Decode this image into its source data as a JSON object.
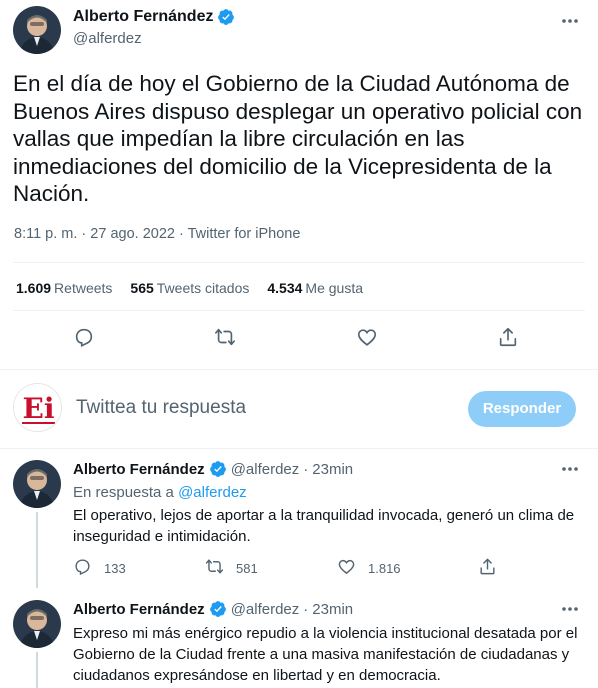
{
  "main_tweet": {
    "author_name": "Alberto Fernández",
    "author_handle": "@alferdez",
    "text": "En el día de hoy el Gobierno de la Ciudad Autónoma de Buenos Aires dispuso desplegar un operativo policial con vallas que impedían la libre circulación en las inmediaciones del domicilio de la Vicepresidenta de la Nación.",
    "time": "8:11 p. m. · 27 ago. 2022 ·",
    "source": "Twitter for iPhone",
    "stats": {
      "retweets_count": "1.609",
      "retweets_label": "Retweets",
      "quotes_count": "565",
      "quotes_label": "Tweets citados",
      "likes_count": "4.534",
      "likes_label": "Me gusta"
    },
    "actions": [
      "reply-icon",
      "retweet-icon",
      "like-icon",
      "share-icon"
    ]
  },
  "reply_box": {
    "logo_text": "Ei",
    "placeholder": "Twittea tu respuesta",
    "button_label": "Responder"
  },
  "replies": [
    {
      "author_name": "Alberto Fernández",
      "author_handle": "@alferdez",
      "dot": "·",
      "time": "23min",
      "reply_to_prefix": "En respuesta a",
      "reply_to_handle": "@alferdez",
      "text": "El operativo, lejos de aportar a la tranquilidad invocada, generó un clima de inseguridad e intimidación.",
      "replies_count": "133",
      "retweets_count": "581",
      "likes_count": "1.816"
    },
    {
      "author_name": "Alberto Fernández",
      "author_handle": "@alferdez",
      "dot": "·",
      "time": "23min",
      "text": "Expreso mi más enérgico repudio a la violencia institucional desatada por el Gobierno de la Ciudad frente a una masiva manifestación de ciudadanas y ciudadanos expresándose en libertad y en democracia."
    }
  ],
  "colors": {
    "accent": "#1d9bf0",
    "reply_button": "#8ecdf8",
    "secondary_text": "#536471",
    "logo_red": "#c8102e"
  }
}
